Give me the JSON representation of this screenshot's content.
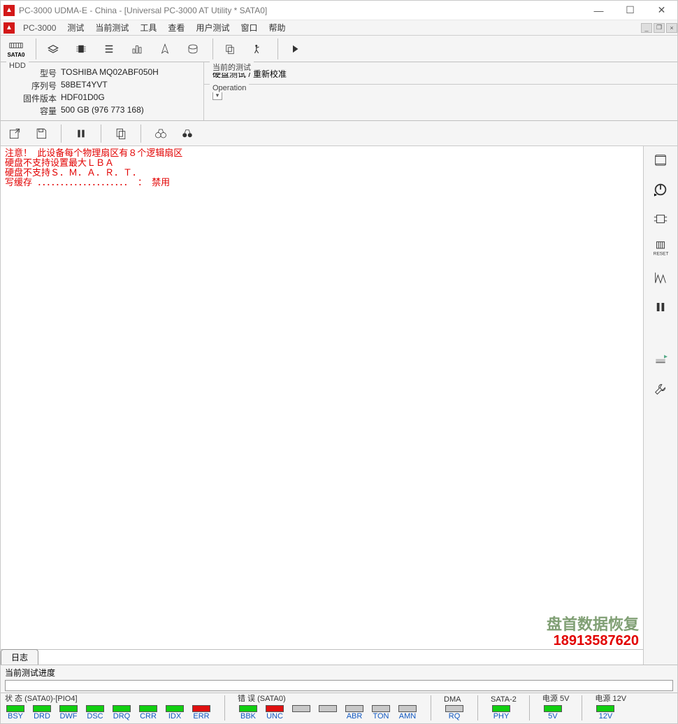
{
  "title": "PC-3000 UDMA-E - China - [Universal PC-3000 AT Utility * SATA0]",
  "menu": {
    "app": "PC-3000",
    "items": [
      "测试",
      "当前测试",
      "工具",
      "查看",
      "用户测试",
      "窗口",
      "帮助"
    ]
  },
  "toolbar": {
    "sata_label": "SATA0"
  },
  "hdd": {
    "group": "HDD",
    "model_label": "型号",
    "model": "TOSHIBA MQ02ABF050H",
    "serial_label": "序列号",
    "serial": "58BET4YVT",
    "fw_label": "固件版本",
    "fw": "HDF01D0G",
    "cap_label": "容量",
    "cap": "500 GB (976 773 168)"
  },
  "current_test": {
    "group": "当前的测试",
    "text": "硬盘测试 / 重新校准"
  },
  "operation": {
    "group": "Operation"
  },
  "log": {
    "line1": "注意！  此设备每个物理扇区有８个逻辑扇区",
    "line2": "硬盘不支持设置最大ＬＢＡ",
    "line3": "硬盘不支持Ｓ．Ｍ．Ａ．Ｒ．Ｔ．",
    "line4": "写缓存  ．．．．．．．．．．．．．．．．．．．．  ：  禁用",
    "tab": "日志",
    "watermark1": "盘首数据恢复",
    "watermark2": "18913587620"
  },
  "progress": {
    "label": "当前测试进度"
  },
  "status": {
    "sata": {
      "label": "状 态 (SATA0)-[PIO4]",
      "leds": [
        {
          "lbl": "BSY",
          "cls": "green"
        },
        {
          "lbl": "DRD",
          "cls": "green"
        },
        {
          "lbl": "DWF",
          "cls": "green"
        },
        {
          "lbl": "DSC",
          "cls": "green"
        },
        {
          "lbl": "DRQ",
          "cls": "green"
        },
        {
          "lbl": "CRR",
          "cls": "green"
        },
        {
          "lbl": "IDX",
          "cls": "green"
        },
        {
          "lbl": "ERR",
          "cls": "red"
        }
      ]
    },
    "err": {
      "label": "错 误 (SATA0)",
      "leds": [
        {
          "lbl": "BBK",
          "cls": "green"
        },
        {
          "lbl": "UNC",
          "cls": "red"
        },
        {
          "lbl": "",
          "cls": "off"
        },
        {
          "lbl": "",
          "cls": "off"
        },
        {
          "lbl": "ABR",
          "cls": "off"
        },
        {
          "lbl": "TON",
          "cls": "off"
        },
        {
          "lbl": "AMN",
          "cls": "off"
        }
      ]
    },
    "dma": {
      "label": "DMA",
      "leds": [
        {
          "lbl": "RQ",
          "cls": "off"
        }
      ]
    },
    "sata2": {
      "label": "SATA-2",
      "leds": [
        {
          "lbl": "PHY",
          "cls": "green"
        }
      ]
    },
    "p5": {
      "label": "电源 5V",
      "leds": [
        {
          "lbl": "5V",
          "cls": "green"
        }
      ]
    },
    "p12": {
      "label": "电源 12V",
      "leds": [
        {
          "lbl": "12V",
          "cls": "green"
        }
      ]
    }
  }
}
